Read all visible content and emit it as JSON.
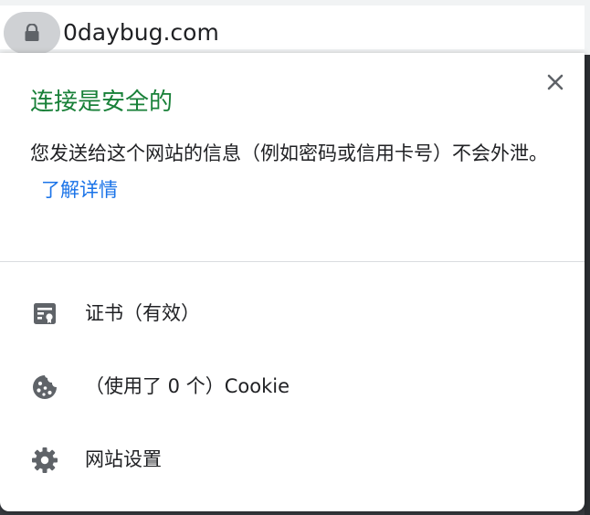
{
  "omnibox": {
    "url": "0daybug.com",
    "lock_icon": "lock-icon"
  },
  "popup": {
    "title": "连接是安全的",
    "description": "您发送给这个网站的信息（例如密码或信用卡号）不会外泄。",
    "learn_more": "了解详情",
    "close_icon": "close-icon",
    "title_color": "#188038",
    "link_color": "#1a73e8"
  },
  "menu": {
    "certificate": {
      "label": "证书（有效）",
      "icon": "certificate-icon"
    },
    "cookies": {
      "label": "（使用了 0 个）Cookie",
      "icon": "cookie-icon"
    },
    "site_settings": {
      "label": "网站设置",
      "icon": "gear-icon"
    }
  }
}
